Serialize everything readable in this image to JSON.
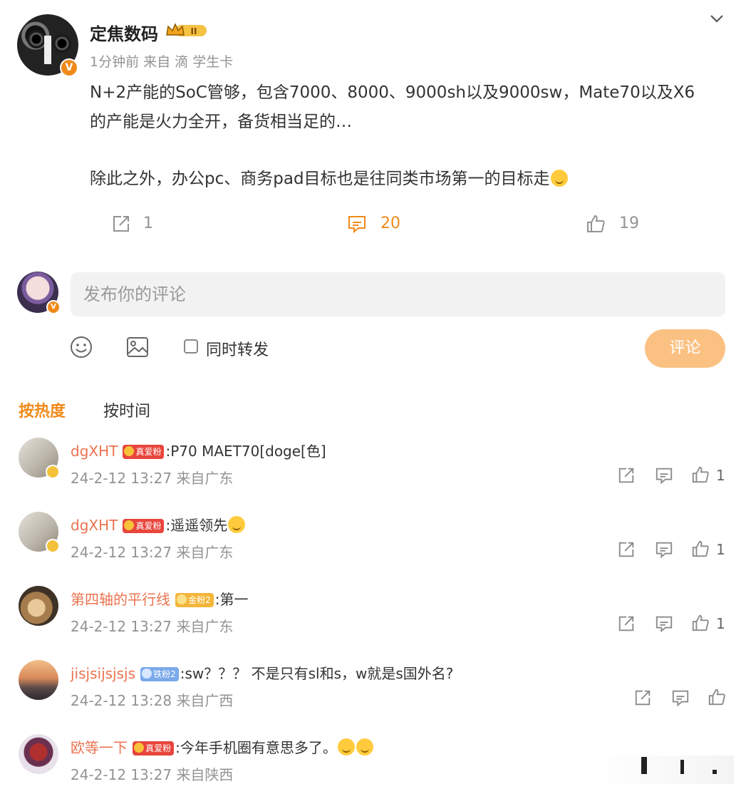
{
  "post": {
    "author": "定焦数码",
    "meta": "1分钟前 来自 滴 学生卡",
    "text_lines": [
      "N+2产能的SoC管够，包含7000、8000、9000sh以及9000sw，Mate70以及X6",
      "的产能是火力全开，备货相当足的…",
      "除此之外，办公pc、商务pad目标也是往同类市场第一的目标走"
    ],
    "verify_badge": "V",
    "rank_badge": "II",
    "actions": {
      "repost_count": "1",
      "comment_count": "20",
      "like_count": "19"
    }
  },
  "composer": {
    "placeholder": "发布你的评论",
    "also_repost_label": "同时转发",
    "submit_label": "评论"
  },
  "tabs": {
    "hot": "按热度",
    "time": "按时间"
  },
  "comments": [
    {
      "name": "dgXHT",
      "badge": "真爱粉",
      "text": ":P70 MAET70[doge[色]",
      "meta": "24-2-12 13:27 来自广东",
      "likes": "1"
    },
    {
      "name": "dgXHT",
      "badge": "真爱粉",
      "text": ":遥遥领先",
      "meta": "24-2-12 13:27 来自广东",
      "likes": "1"
    },
    {
      "name": "第四轴的平行线",
      "badge": "金粉2",
      "text": ":第一",
      "meta": "24-2-12 13:27 来自广东",
      "likes": "1"
    },
    {
      "name": "jisjsijsjsjs",
      "badge": "铁粉2",
      "text": ":sw？？？ 不是只有sl和s，w就是s国外名?",
      "meta": "24-2-12 13:28 来自广西",
      "likes": ""
    },
    {
      "name": "欧等一下",
      "badge": "真爱粉",
      "text": ":今年手机圈有意思多了。",
      "meta": "24-2-12 13:27 来自陕西",
      "likes": ""
    }
  ],
  "colors": {
    "accent": "#f08a1a",
    "username": "#eb7350",
    "muted": "#939393",
    "submit_bg": "#fbc183"
  }
}
